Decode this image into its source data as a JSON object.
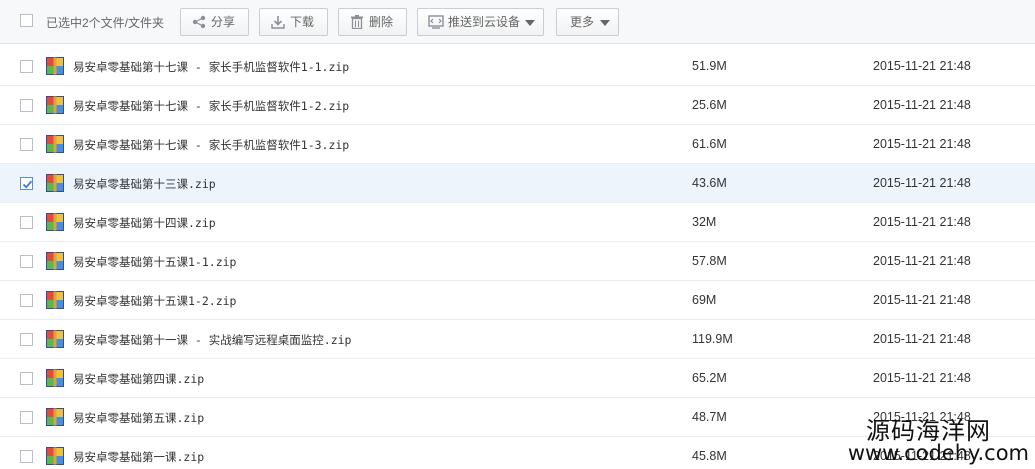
{
  "toolbar": {
    "selection_text": "已选中2个文件/文件夹",
    "share_label": "分享",
    "download_label": "下载",
    "delete_label": "删除",
    "push_label": "推送到云设备",
    "more_label": "更多"
  },
  "files": [
    {
      "name": "易安卓零基础第十七课 - 家长手机监督软件1-1.zip",
      "size": "51.9M",
      "date": "2015-11-21 21:48",
      "selected": false
    },
    {
      "name": "易安卓零基础第十七课 - 家长手机监督软件1-2.zip",
      "size": "25.6M",
      "date": "2015-11-21 21:48",
      "selected": false
    },
    {
      "name": "易安卓零基础第十七课 - 家长手机监督软件1-3.zip",
      "size": "61.6M",
      "date": "2015-11-21 21:48",
      "selected": false
    },
    {
      "name": "易安卓零基础第十三课.zip",
      "size": "43.6M",
      "date": "2015-11-21 21:48",
      "selected": true
    },
    {
      "name": "易安卓零基础第十四课.zip",
      "size": "32M",
      "date": "2015-11-21 21:48",
      "selected": false
    },
    {
      "name": "易安卓零基础第十五课1-1.zip",
      "size": "57.8M",
      "date": "2015-11-21 21:48",
      "selected": false
    },
    {
      "name": "易安卓零基础第十五课1-2.zip",
      "size": "69M",
      "date": "2015-11-21 21:48",
      "selected": false
    },
    {
      "name": "易安卓零基础第十一课 - 实战编写远程桌面监控.zip",
      "size": "119.9M",
      "date": "2015-11-21 21:48",
      "selected": false
    },
    {
      "name": "易安卓零基础第四课.zip",
      "size": "65.2M",
      "date": "2015-11-21 21:48",
      "selected": false
    },
    {
      "name": "易安卓零基础第五课.zip",
      "size": "48.7M",
      "date": "2015-11-21 21:48",
      "selected": false
    },
    {
      "name": "易安卓零基础第一课.zip",
      "size": "45.8M",
      "date": "2015-11-21 21:48",
      "selected": false
    }
  ],
  "watermark": {
    "line1": "源码海洋网",
    "line2": "www.codehy.com"
  },
  "icons": {
    "share": "share-icon",
    "download": "download-icon",
    "delete": "trash-icon",
    "push": "cloud-device-icon",
    "file": "zip-archive-icon"
  },
  "colors": {
    "toolbar_bg": "#f7f8fa",
    "selected_row_bg": "#eef4fc",
    "check_color": "#3b78d8",
    "row_border": "#e8ebf0"
  }
}
